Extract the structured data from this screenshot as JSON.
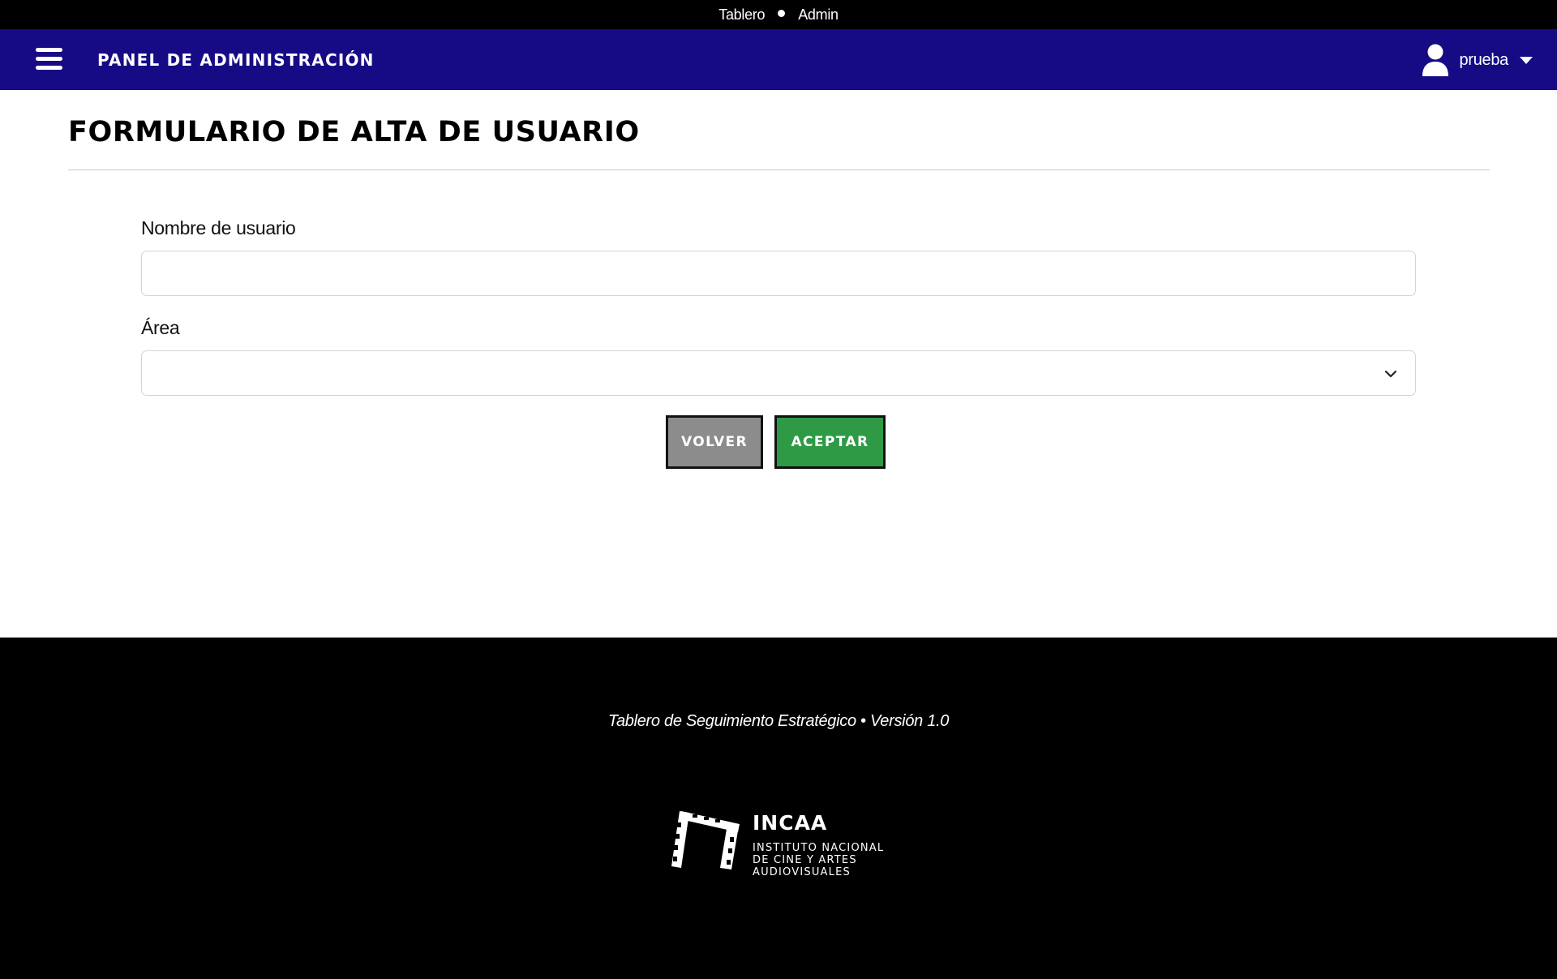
{
  "topbar": {
    "link_dashboard": "Tablero",
    "link_admin": "Admin"
  },
  "navbar": {
    "title": "PANEL DE ADMINISTRACIÓN",
    "menu_icon": "hamburger-menu-icon",
    "user": {
      "icon": "user-icon",
      "name": "prueba",
      "dropdown_icon": "caret-down-icon"
    },
    "background_color": "#170b85"
  },
  "page": {
    "title": "FORMULARIO DE ALTA DE USUARIO"
  },
  "form": {
    "username": {
      "label": "Nombre de usuario",
      "value": "",
      "placeholder": ""
    },
    "area": {
      "label": "Área",
      "selected": "",
      "dropdown_icon": "chevron-down-icon"
    },
    "buttons": {
      "back": "VOLVER",
      "accept": "ACEPTAR"
    },
    "colors": {
      "back_button": "#8c8c8c",
      "accept_button": "#2e9a46"
    }
  },
  "footer": {
    "text": "Tablero de Seguimiento Estratégico • Versión 1.0",
    "logo": {
      "name": "INCAA",
      "line1": "INSTITUTO NACIONAL",
      "line2": "DE CINE Y ARTES",
      "line3": "AUDIOVISUALES"
    }
  }
}
